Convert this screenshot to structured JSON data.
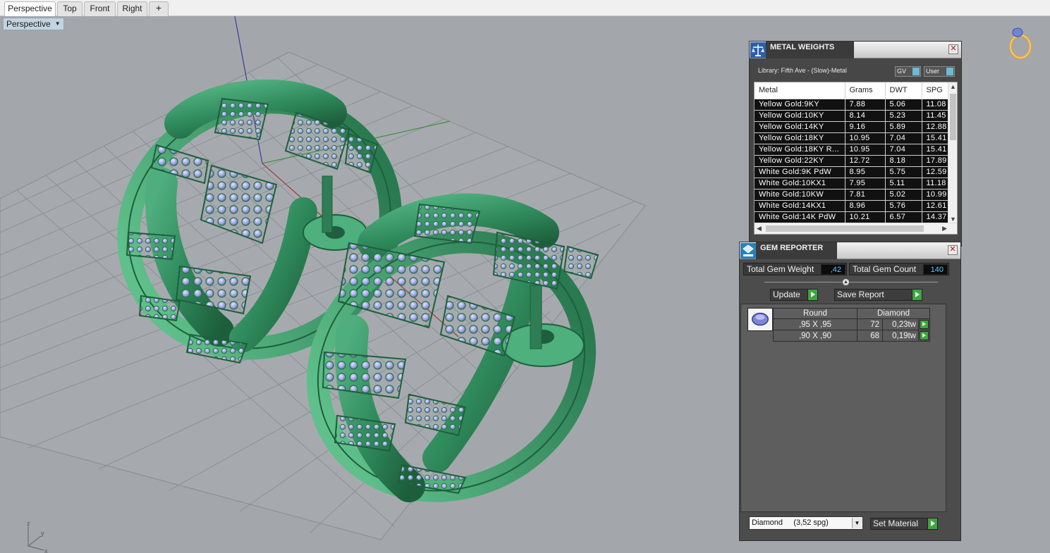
{
  "tabs": [
    {
      "label": "Perspective",
      "active": true
    },
    {
      "label": "Top",
      "active": false
    },
    {
      "label": "Front",
      "active": false
    },
    {
      "label": "Right",
      "active": false
    }
  ],
  "add_tab_icon": "plus-icon",
  "viewport": {
    "label": "Perspective",
    "menu_icon": "chevron-down-icon"
  },
  "metal_weights": {
    "title": "METAL WEIGHTS",
    "library": "Library: Fifth Ave - (Slow)-Metal",
    "toggle_gv": "GV",
    "toggle_user": "User",
    "columns": [
      "Metal",
      "Grams",
      "DWT",
      "SPG"
    ],
    "rows": [
      [
        "Yellow Gold:9KY",
        "7.88",
        "5.06",
        "11.08"
      ],
      [
        "Yellow Gold:10KY",
        "8.14",
        "5.23",
        "11.45"
      ],
      [
        "Yellow Gold:14KY",
        "9.16",
        "5.89",
        "12.88"
      ],
      [
        "Yellow Gold:18KY",
        "10.95",
        "7.04",
        "15.41"
      ],
      [
        "Yellow Gold:18KY R...",
        "10.95",
        "7.04",
        "15.41"
      ],
      [
        "Yellow Gold:22KY",
        "12.72",
        "8.18",
        "17.89"
      ],
      [
        "White Gold:9K PdW",
        "8.95",
        "5.75",
        "12.59"
      ],
      [
        "White Gold:10KX1",
        "7.95",
        "5.11",
        "11.18"
      ],
      [
        "White Gold:10KW",
        "7.81",
        "5.02",
        "10.99"
      ],
      [
        "White Gold:14KX1",
        "8.96",
        "5.76",
        "12.61"
      ],
      [
        "White Gold:14K PdW",
        "10.21",
        "6.57",
        "14.37"
      ]
    ]
  },
  "gem_reporter": {
    "title": "GEM REPORTER",
    "total_weight_label": "Total Gem Weight",
    "total_weight_value": ",42",
    "total_count_label": "Total Gem Count",
    "total_count_value": "140",
    "update_label": "Update",
    "save_report_label": "Save Report",
    "grid_headers": [
      "Round",
      "Diamond"
    ],
    "gems": [
      {
        "size": ",95 X ,95",
        "count": "72",
        "tw": "0,23tw"
      },
      {
        "size": ",90 X ,90",
        "count": "68",
        "tw": "0,19tw"
      }
    ],
    "material_select": "Diamond     (3,52 spg)",
    "set_material_label": "Set Material"
  },
  "colors": {
    "viewport_bg": "#a3a7ab",
    "ring_green": "#2f8a5b",
    "gem_lavender": "#9aa3e0",
    "accent_cyan": "#5cc7ff",
    "play_green": "#3fa63f"
  }
}
